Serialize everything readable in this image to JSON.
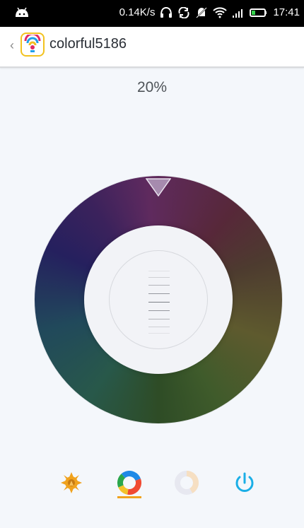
{
  "status_bar": {
    "speed": "0.14K/s",
    "time": "17:41"
  },
  "app_bar": {
    "back_symbol": "‹",
    "title": "colorful5186"
  },
  "brightness": {
    "value": "20%"
  },
  "bottom_bar": {
    "buttons": [
      {
        "name": "sun-mode",
        "icon": "sun-icon"
      },
      {
        "name": "color-mode",
        "icon": "color-wheel-icon"
      },
      {
        "name": "white-mode",
        "icon": "ring-icon"
      },
      {
        "name": "power",
        "icon": "power-icon"
      }
    ],
    "active_index": 1
  },
  "colors": {
    "status_bg": "#000000",
    "app_bar_bg": "#ffffff",
    "page_bg": "#f4f7fb",
    "accent_orange": "#f0a21d",
    "power_blue": "#1aaee6"
  }
}
